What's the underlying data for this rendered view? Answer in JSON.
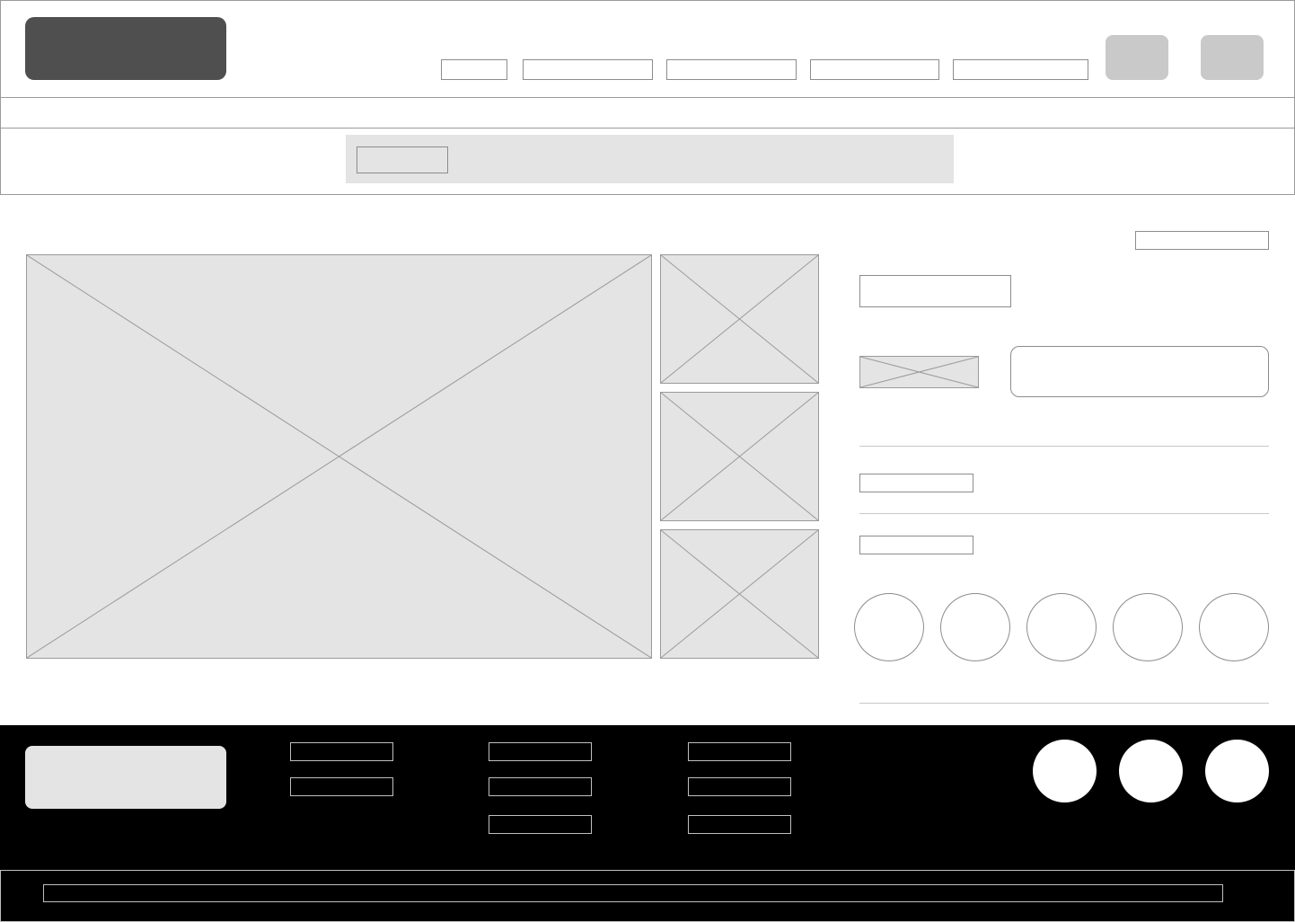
{
  "header": {
    "logo_label": "",
    "nav": [
      {
        "label": ""
      },
      {
        "label": ""
      },
      {
        "label": ""
      },
      {
        "label": ""
      },
      {
        "label": ""
      }
    ],
    "action_buttons": [
      {
        "label": ""
      },
      {
        "label": ""
      }
    ]
  },
  "subnav": {
    "text": ""
  },
  "search": {
    "button_label": "",
    "placeholder": ""
  },
  "product": {
    "top_link": "",
    "title": "",
    "cta_label": "",
    "option_label_1": "",
    "option_label_2": "",
    "swatches": [
      "",
      "",
      "",
      "",
      ""
    ]
  },
  "footer": {
    "logo_label": "",
    "columns": [
      {
        "links": [
          "",
          ""
        ]
      },
      {
        "links": [
          "",
          "",
          ""
        ]
      },
      {
        "links": [
          "",
          "",
          ""
        ]
      }
    ],
    "social": [
      {
        "icon": "social-icon"
      },
      {
        "icon": "social-icon"
      },
      {
        "icon": "social-icon"
      }
    ],
    "bottom_text": ""
  }
}
